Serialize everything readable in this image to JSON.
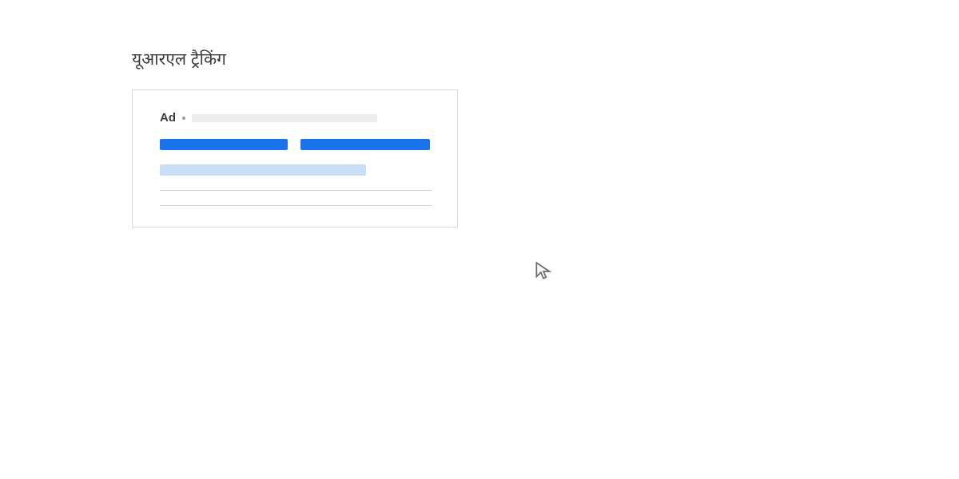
{
  "heading": "यूआरएल ट्रैकिंग",
  "ad_preview": {
    "ad_label": "Ad"
  }
}
